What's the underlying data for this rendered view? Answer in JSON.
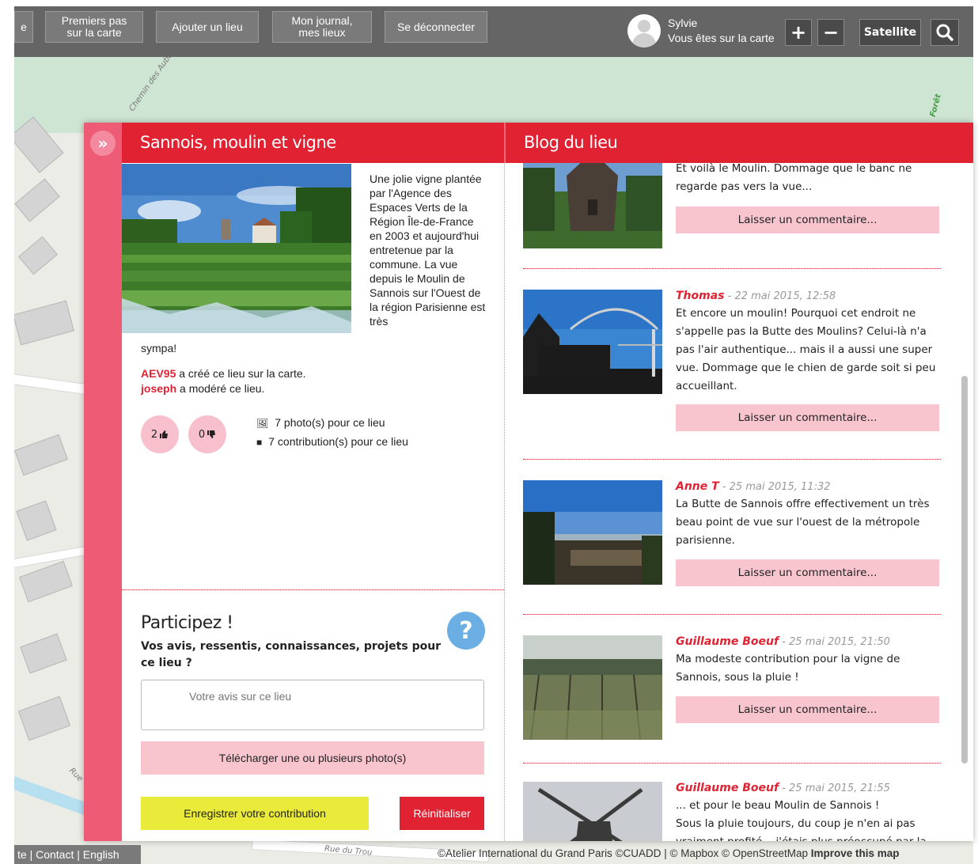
{
  "topbar": {
    "nav": [
      {
        "label": "e"
      },
      {
        "label": "Premiers pas\nsur la carte"
      },
      {
        "label": "Ajouter un lieu"
      },
      {
        "label": "Mon journal,\nmes lieux"
      },
      {
        "label": "Se déconnecter"
      }
    ],
    "user": {
      "name": "Sylvie",
      "status": "Vous êtes sur la carte"
    },
    "zoom_in": "+",
    "zoom_out": "−",
    "satellite_label": "Satellite"
  },
  "map_labels": {
    "street1": "Chemin des Aubes",
    "street2": "Rue du Trou",
    "street3": "Rue",
    "forest": "Forêt"
  },
  "place": {
    "title": "Sannois, moulin et vigne",
    "description": "Une jolie vigne plantée par l'Agence des Espaces Verts de la Région Île-de-France en 2003 et aujourd'hui entretenue par la commune. La vue depuis le Moulin de Sannois sur l'Ouest de la région Parisienne est très",
    "description_end": "sympa!",
    "creator": {
      "name": "AEV95",
      "text": "a créé ce lieu sur la carte."
    },
    "moderator": {
      "name": "joseph",
      "text": "a modéré ce lieu."
    },
    "likes": "2",
    "dislikes": "0",
    "photos_count": "7 photo(s) pour ce lieu",
    "contrib_count": "7 contribution(s) pour ce lieu"
  },
  "participate": {
    "title": "Participez !",
    "subtitle": "Vos avis, ressentis, connaissances, projets pour ce lieu ?",
    "placeholder": "Votre avis sur ce lieu",
    "upload_label": "Télécharger une ou plusieurs photo(s)",
    "save_label": "Enregistrer votre contribution",
    "reset_label": "Réinitialiser"
  },
  "blog": {
    "title": "Blog du lieu",
    "comment_label": "Laisser un commentaire...",
    "entries": [
      {
        "author": "",
        "date": "",
        "text": "Et voilà le Moulin. Dommage que le banc ne regarde pas vers la vue..."
      },
      {
        "author": "Thomas",
        "date": " - 22 mai 2015, 12:58",
        "text": "Et encore un moulin! Pourquoi cet endroit ne s'appelle pas la Butte des Moulins? Celui-là n'a pas l'air authentique... mais il a aussi une super vue. Dommage que le chien de garde soit si peu accueillant."
      },
      {
        "author": "Anne T",
        "date": " - 25 mai 2015, 11:32",
        "text": "La Butte de Sannois offre effectivement un très beau point de vue sur l'ouest de la métropole parisienne."
      },
      {
        "author": "Guillaume Boeuf",
        "date": " - 25 mai 2015, 21:50",
        "text": "Ma modeste contribution pour la vigne de Sannois, sous la pluie !"
      },
      {
        "author": "Guillaume Boeuf",
        "date": " - 25 mai 2015, 21:55",
        "text": "... et pour le beau Moulin de Sannois !\nSous la pluie toujours, du coup je n'en ai pas vraiment profité... j'étais plus préoccupé par la"
      }
    ]
  },
  "footer": {
    "links": [
      "te",
      "Contact",
      "English"
    ],
    "attribution": "©Atelier International du Grand Paris ©CUADD | © Mapbox © OpenStreetMap",
    "improve": "Improve this map"
  }
}
